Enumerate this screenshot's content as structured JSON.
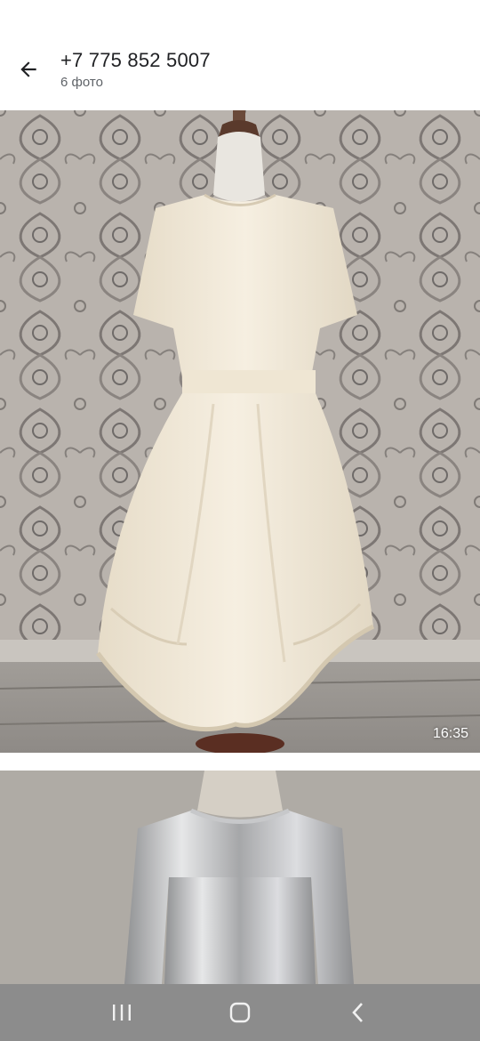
{
  "header": {
    "title": "+7 775 852 5007",
    "subtitle": "6 фото",
    "back_icon": "arrow-back-icon"
  },
  "gallery": {
    "photo1": {
      "timestamp": "16:35"
    }
  },
  "navbar": {
    "icons": [
      "recent-apps-icon",
      "home-icon",
      "back-icon"
    ]
  }
}
